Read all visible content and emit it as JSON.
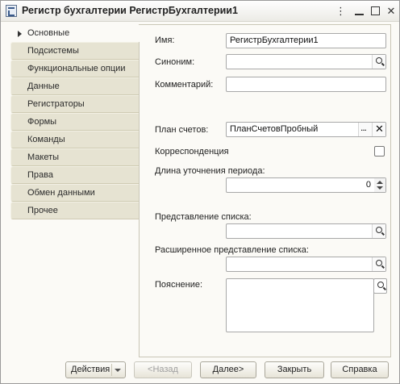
{
  "window": {
    "title": "Регистр бухгалтерии РегистрБухгалтерии1",
    "more_label": "⋮",
    "minimize_label": "",
    "maximize_label": "",
    "close_label": "✕"
  },
  "tabs": [
    {
      "label": "Основные",
      "active": true
    },
    {
      "label": "Подсистемы"
    },
    {
      "label": "Функциональные опции"
    },
    {
      "label": "Данные"
    },
    {
      "label": "Регистраторы"
    },
    {
      "label": "Формы"
    },
    {
      "label": "Команды"
    },
    {
      "label": "Макеты"
    },
    {
      "label": "Права"
    },
    {
      "label": "Обмен данными"
    },
    {
      "label": "Прочее"
    }
  ],
  "form": {
    "name_label": "Имя:",
    "name_value": "РегистрБухгалтерии1",
    "synonym_label": "Синоним:",
    "synonym_value": "",
    "comment_label": "Комментарий:",
    "comment_value": "",
    "chart_label": "План счетов:",
    "chart_value": "ПланСчетовПробный",
    "chart_select_label": "...",
    "chart_clear_label": "✕",
    "correspondence_label": "Корреспонденция",
    "correspondence_checked": false,
    "period_label": "Длина уточнения периода:",
    "period_value": "0",
    "list_repr_label": "Представление списка:",
    "list_repr_value": "",
    "ext_list_repr_label": "Расширенное представление списка:",
    "ext_list_repr_value": "",
    "explanation_label": "Пояснение:",
    "explanation_value": ""
  },
  "buttons": {
    "actions": "Действия",
    "back": "<Назад",
    "next": "Далее>",
    "close": "Закрыть",
    "help": "Справка"
  }
}
